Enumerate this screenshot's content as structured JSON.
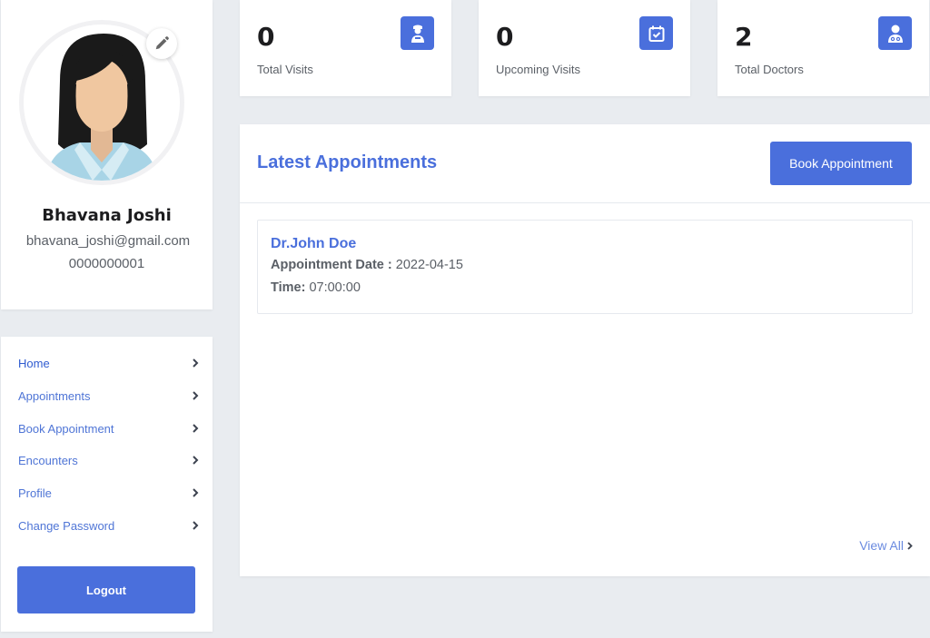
{
  "profile": {
    "name": "Bhavana Joshi",
    "email": "bhavana_joshi@gmail.com",
    "phone": "0000000001"
  },
  "nav": {
    "items": [
      {
        "label": "Home"
      },
      {
        "label": "Appointments"
      },
      {
        "label": "Book Appointment"
      },
      {
        "label": "Encounters"
      },
      {
        "label": "Profile"
      },
      {
        "label": "Change Password"
      }
    ],
    "logout_label": "Logout"
  },
  "stats": [
    {
      "value": "0",
      "label": "Total Visits",
      "icon": "doctor-visit-icon"
    },
    {
      "value": "0",
      "label": "Upcoming Visits",
      "icon": "calendar-check-icon"
    },
    {
      "value": "2",
      "label": "Total Doctors",
      "icon": "user-doctor-icon"
    }
  ],
  "appointments": {
    "title": "Latest Appointments",
    "book_label": "Book Appointment",
    "items": [
      {
        "doctor": "Dr.John Doe",
        "date_label": "Appointment Date :",
        "date_value": "2022-04-15",
        "time_label": "Time:",
        "time_value": "07:00:00"
      }
    ],
    "view_all_label": "View All"
  },
  "colors": {
    "accent": "#4a6fdc",
    "background": "#e9ecf0",
    "card": "#ffffff"
  }
}
